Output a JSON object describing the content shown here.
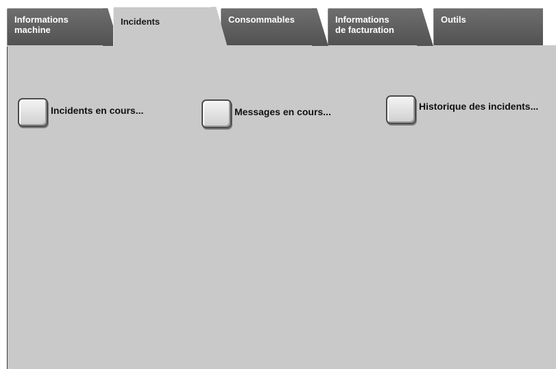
{
  "tabs": [
    {
      "label": "Informations machine",
      "line1": "Informations",
      "line2": "machine",
      "active": false
    },
    {
      "label": "Incidents",
      "line1": "Incidents",
      "line2": "",
      "active": true
    },
    {
      "label": "Consommables",
      "line1": "Consommables",
      "line2": "",
      "active": false
    },
    {
      "label": "Informations de facturation",
      "line1": "Informations",
      "line2": "de facturation",
      "active": false
    },
    {
      "label": "Outils",
      "line1": "Outils",
      "line2": "",
      "active": false
    }
  ],
  "options": [
    {
      "label": "Incidents en cours..."
    },
    {
      "label": "Messages en cours..."
    },
    {
      "label": "Historique des incidents..."
    }
  ],
  "colors": {
    "tab_inactive": "#5e5e5e",
    "tab_active": "#c9c9c9",
    "panel": "#c9c9c9"
  }
}
